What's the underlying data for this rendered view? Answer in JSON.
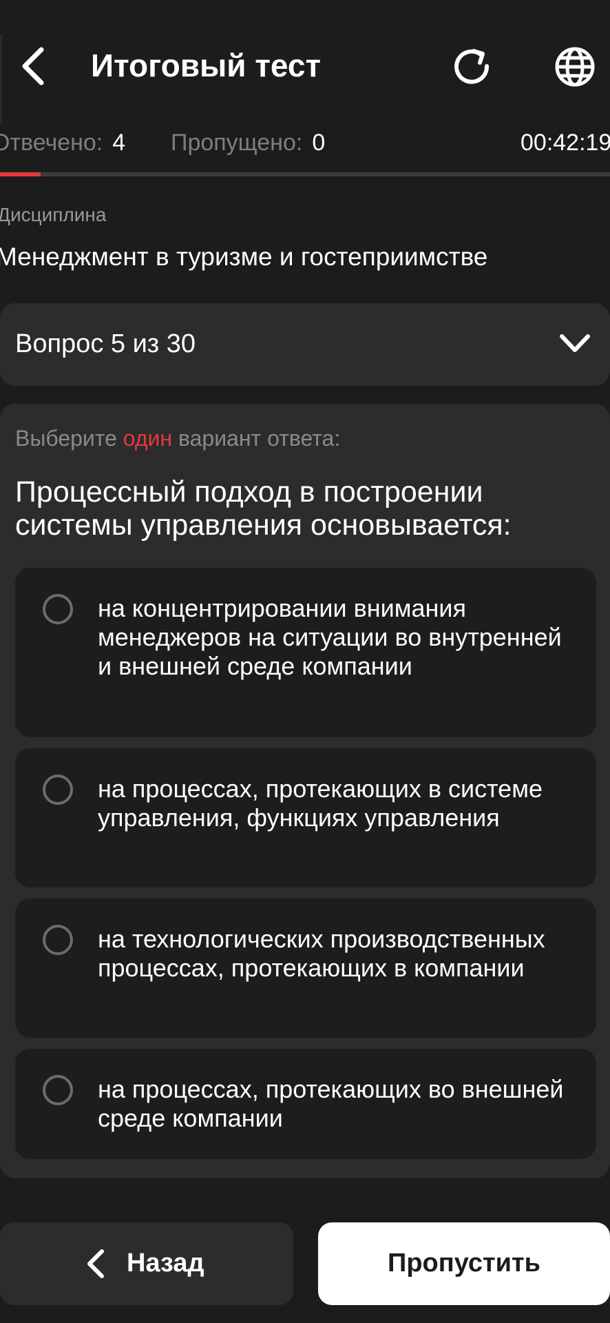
{
  "header": {
    "title": "Итоговый тест"
  },
  "stats": {
    "answered_label": "Отвечено:",
    "answered_value": "4",
    "skipped_label": "Пропущено:",
    "skipped_value": "0",
    "timer": "00:42:19",
    "progress_fraction": 0.0667
  },
  "discipline": {
    "label": "Дисциплина",
    "name": "Менеджмент в туризме и гостеприимстве"
  },
  "question_selector": {
    "label": "Вопрос 5 из 30"
  },
  "question": {
    "instruction_before": "Выберите ",
    "instruction_accent": "один",
    "instruction_after": " вариант ответа:",
    "text": "Процессный подход в построении системы управления основывается:",
    "options": [
      {
        "text": "на концентрировании внимания менеджеров на ситуации во внутренней и внешней среде компании"
      },
      {
        "text": "на процессах, протекающих в системе управления, функциях управления"
      },
      {
        "text": "на технологических производственных процессах, протекающих в компании"
      },
      {
        "text": "на процессах, протекающих во внешней среде компании"
      }
    ]
  },
  "footer": {
    "back_label": "Назад",
    "skip_label": "Пропустить"
  },
  "colors": {
    "background": "#1c1c1c",
    "surface": "#2c2c2c",
    "option_surface": "#1d1d1d",
    "accent": "#e5383b",
    "text": "#ffffff",
    "muted": "#8a8a8a"
  },
  "icons": {
    "back": "chevron-left-icon",
    "reload": "reload-icon",
    "language": "globe-icon",
    "expand": "chevron-down-icon",
    "option": "radio-icon"
  }
}
